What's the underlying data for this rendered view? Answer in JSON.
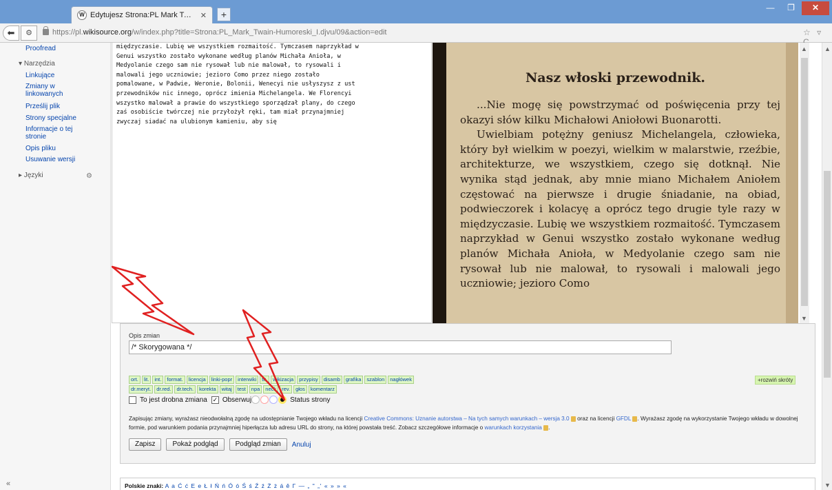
{
  "browser": {
    "tab_title": "Edytujesz Strona:PL Mark Twain-Humor...",
    "tab_favicon": "W",
    "new_tab": "+",
    "url_prefix": "https://pl.",
    "url_host": "wikisource.org",
    "url_path": "/w/index.php?title=Strona:PL_Mark_Twain-Humoreski_I.djvu/09&action=edit",
    "url_icons": "☆ ▿ C"
  },
  "sidebar": {
    "proofread": "Proofread",
    "tools_heading": "Narzędzia",
    "tools": [
      "Linkujące",
      "Zmiany w linkowanych",
      "Prześlij plik",
      "Strony specjalne",
      "Informacje o tej stronie",
      "Opis pliku",
      "Usuwanie wersji"
    ],
    "languages": "Języki",
    "collapse_glyph": "«"
  },
  "editor": {
    "text": "międzyczasie. Lubię we wszystkiem rozmaitość. Tymczasem naprzykład w\nGenui wszystko zostało wykonane według planów Michała Anioła, w\nMedyolanie czego sam nie rysował lub nie malował, to rysowali i\nmalowali jego uczniowie; jezioro Como przez niego zostało\npomalowane, w Padwie, Weronie, Bolonii, Wenecyi nie usłyszysz z ust\nprzewodników nic innego, oprócz imienia Michelangela. We Florencyi\nwszystko malował a prawie do wszystkiego sporządzał plany, do czego\nzaś osobiście twórczej nie przyłożył ręki, tam miał przynajmniej\nzwyczaj siadać na ulubionym kamieniu, aby się"
  },
  "scan": {
    "title": "Nasz włoski przewodnik.",
    "paragraph1": "...Nie mogę się powstrzymać od poświęcenia przy tej okazyi słów kilku Michałowi Aniołowi Buonarotti.",
    "paragraph2": "Uwielbiam potężny geniusz Michelangela, człowieka, który był wielkim w poezyi, wielkim w malarstwie, rzeźbie, architekturze, we wszystkiem, czego się dotknął. Nie wynika stąd jednak, aby mnie miano Michałem Aniołem częstować na pierwsze i drugie śniadanie, na obiad, podwieczorek i kolacyę a oprócz tego drugie tyle razy w międzyczasie. Lubię we wszystkiem rozmaitość. Tymczasem naprzykład w Genui wszystko zostało wykonane według planów Michała Anioła, w Medyolanie czego sam nie rysował lub nie malował, to rysowali i malowali jego uczniowie; jezioro Como"
  },
  "save": {
    "summary_label": "Opis zmian",
    "summary_value": "/* Skorygowana */",
    "tags": [
      "ort.",
      "lit.",
      "int.",
      "format.",
      "licencja",
      "linki-popr",
      "interwiki",
      "tłt.",
      "wikizacja",
      "przypisy",
      "disamb",
      "grafika",
      "szablon",
      "nagłówek",
      "dr.meryt.",
      "dr.red.",
      "dr.tech.",
      "korekta",
      "witaj",
      "test",
      "npa",
      "neck",
      "rev.",
      "głos",
      "komentarz"
    ],
    "expand": "+rozwiń skróty",
    "minor_label": "To jest drobna zmiana",
    "watch_label": "Obserwuj",
    "checked_mark": "✓",
    "status_label": "Status strony",
    "status_colors": [
      "#c0c0c0",
      "#ffa0a0",
      "#b0b0ff",
      "#ffe867"
    ],
    "license_part1": "Zapisując zmiany, wyrażasz nieodwołalną zgodę na udostępnianie Twojego wkładu na licencji ",
    "license_link1": "Creative Commons: Uznanie autorstwa – Na tych samych warunkach – wersja 3.0",
    "license_part2": " oraz na licencji ",
    "license_link2": "GFDL",
    "license_part3": ". Wyrażasz zgodę na wykorzystanie Twojego wkładu w dowolnej formie, pod warunkiem podania przynajmniej hiperłącza lub adresu URL do strony, na której powstała treść. Zobacz szczegółowe informacje o ",
    "license_link3": "warunkach korzystania",
    "license_part4": ".",
    "save_button": "Zapisz",
    "preview_button": "Pokaż podgląd",
    "diff_button": "Podgląd zmian",
    "cancel_link": "Anuluj"
  },
  "special_chars": {
    "label": "Polskie znaki:",
    "chars": "A a Ć ć E e Ł ł Ń ń Ó ó Ś ś Ź ź Ż ż  á ê Γ — „ \" „' « » » «"
  }
}
